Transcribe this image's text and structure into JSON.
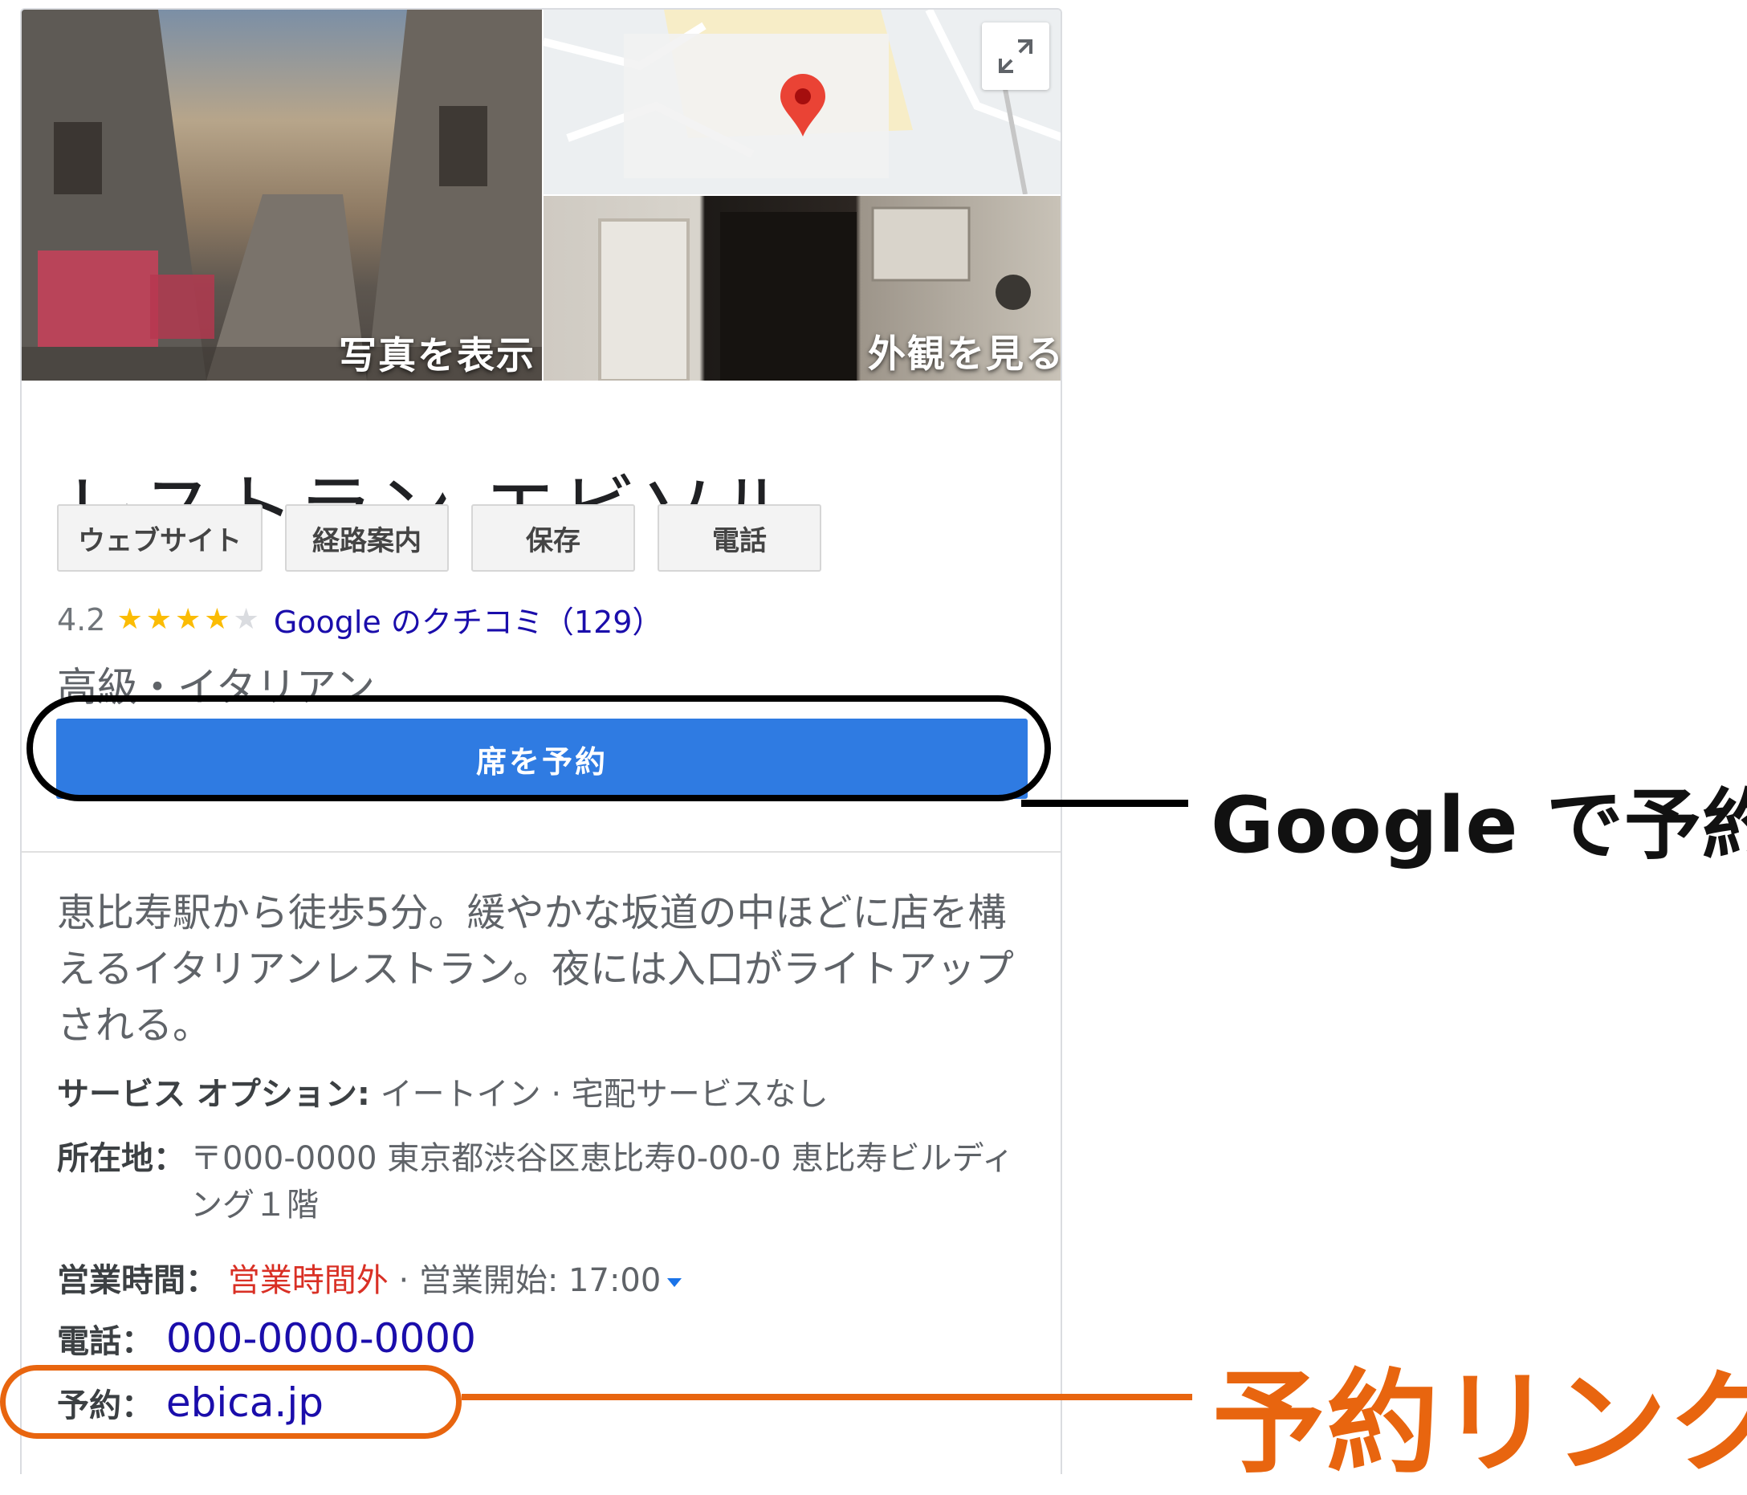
{
  "photos": {
    "view_photos_label": "写真を表示",
    "exterior_label": "外観を見る"
  },
  "place": {
    "title": "レストラン エビソル",
    "rating": "4.2",
    "stars_filled": 4,
    "reviews_link": "Google のクチコミ（129）",
    "category": "高級・イタリアン"
  },
  "chips": [
    "ウェブサイト",
    "経路案内",
    "保存",
    "電話"
  ],
  "reserve_button": "席を予約",
  "description": "恵比寿駅から徒歩5分。緩やかな坂道の中ほどに店を構えるイタリアンレストラン。夜には入口がライトアップされる。",
  "info": {
    "service_label": "サービス オプション:",
    "service_value": "イートイン · 宅配サービスなし",
    "address_label": "所在地：",
    "address_value": "〒000-0000 東京都渋谷区恵比寿0-00-0 恵比寿ビルディング１階",
    "hours_label": "営業時間：",
    "hours_status": "営業時間外",
    "hours_open": "· 営業開始: 17:00",
    "phone_label": "電話：",
    "phone_value": "000-0000-0000",
    "reserve_label": "予約：",
    "reserve_value": "ebica.jp"
  },
  "annotations": {
    "google_reserve": "Google で予約",
    "reserve_link": "予約リンク"
  },
  "colors": {
    "primary_button": "#2f7be2",
    "link": "#1a0dab",
    "closed": "#d93025",
    "annotation_orange": "#e8650f",
    "star": "#fbbc04"
  }
}
